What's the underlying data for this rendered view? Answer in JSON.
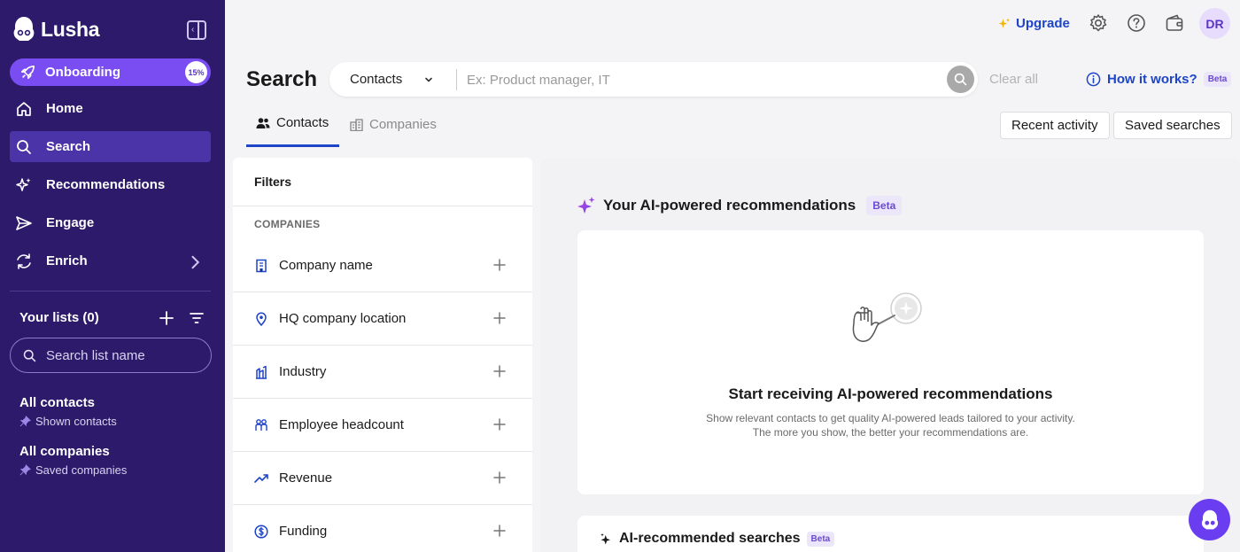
{
  "brand": {
    "name": "Lusha"
  },
  "sidebar": {
    "onboarding": {
      "label": "Onboarding",
      "progress": "15%"
    },
    "nav": [
      {
        "label": "Home",
        "icon": "home-icon"
      },
      {
        "label": "Search",
        "icon": "search-icon"
      },
      {
        "label": "Recommendations",
        "icon": "sparkle-icon"
      },
      {
        "label": "Engage",
        "icon": "send-icon"
      },
      {
        "label": "Enrich",
        "icon": "refresh-icon"
      }
    ],
    "lists_title": "Your lists (0)",
    "list_search_placeholder": "Search list name",
    "lists": [
      {
        "title": "All contacts",
        "subtitle": "Shown contacts"
      },
      {
        "title": "All companies",
        "subtitle": "Saved companies"
      }
    ]
  },
  "topbar": {
    "upgrade": "Upgrade",
    "avatar_initials": "DR"
  },
  "search": {
    "title": "Search",
    "type": "Contacts",
    "placeholder": "Ex: Product manager, IT",
    "clear_all": "Clear all",
    "how_it_works": "How it works?",
    "beta": "Beta"
  },
  "tabs": [
    {
      "label": "Contacts",
      "active": true
    },
    {
      "label": "Companies",
      "active": false
    }
  ],
  "actions": {
    "recent_activity": "Recent activity",
    "saved_searches": "Saved searches"
  },
  "filters": {
    "title": "Filters",
    "section": "COMPANIES",
    "items": [
      {
        "label": "Company name",
        "icon": "building-icon"
      },
      {
        "label": "HQ company location",
        "icon": "location-pin-icon"
      },
      {
        "label": "Industry",
        "icon": "industry-icon"
      },
      {
        "label": "Employee headcount",
        "icon": "people-icon"
      },
      {
        "label": "Revenue",
        "icon": "trend-up-icon"
      },
      {
        "label": "Funding",
        "icon": "dollar-icon"
      }
    ]
  },
  "recommendations": {
    "heading": "Your AI-powered recommendations",
    "badge": "Beta",
    "card_title": "Start receiving AI-powered recommendations",
    "card_desc_line1": "Show relevant contacts to get quality AI-powered leads tailored to your activity.",
    "card_desc_line2": "The more you show, the better your recommendations are.",
    "searches_heading": "AI-recommended searches",
    "searches_badge": "Beta"
  },
  "colors": {
    "sidebar_bg": "#2d1a6b",
    "accent": "#7a4df3",
    "link_blue": "#1e44c8"
  }
}
